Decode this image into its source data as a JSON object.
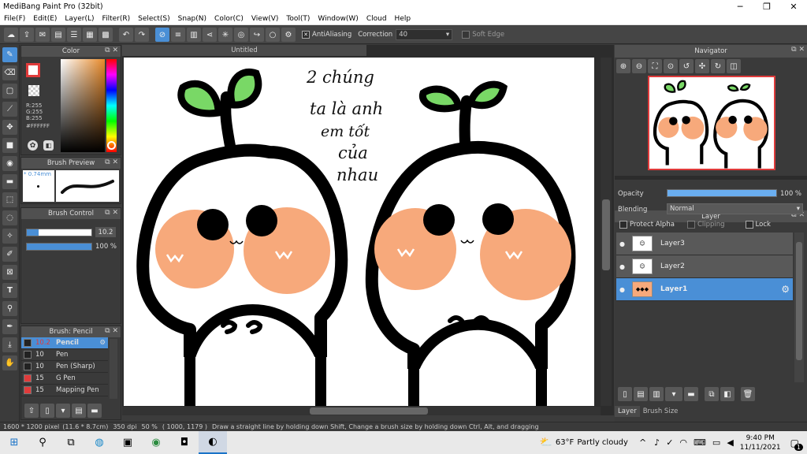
{
  "window": {
    "title": "MediBang Paint Pro (32bit)"
  },
  "menu": [
    "File(F)",
    "Edit(E)",
    "Layer(L)",
    "Filter(R)",
    "Select(S)",
    "Snap(N)",
    "Color(C)",
    "View(V)",
    "Tool(T)",
    "Window(W)",
    "Cloud",
    "Help"
  ],
  "toolbar": {
    "antialiasing": "AntiAliasing",
    "correction_label": "Correction",
    "correction_value": "40",
    "soft_edge": "Soft Edge"
  },
  "color_panel": {
    "title": "Color",
    "r": "R:255",
    "g": "G:255",
    "b": "B:255",
    "hex": "#FFFFFF"
  },
  "brush_preview": {
    "title": "Brush Preview",
    "size": "0.74mm"
  },
  "brush_control": {
    "title": "Brush Control",
    "size": "10.2",
    "opacity": "100 %"
  },
  "brush_list": {
    "title": "Brush: Pencil",
    "items": [
      {
        "size": "10.2",
        "name": "Pencil",
        "color": "#222222"
      },
      {
        "size": "10",
        "name": "Pen",
        "color": "#222222"
      },
      {
        "size": "10",
        "name": "Pen (Sharp)",
        "color": "#222222"
      },
      {
        "size": "15",
        "name": "G Pen",
        "color": "#e03b3b"
      },
      {
        "size": "15",
        "name": "Mapping Pen",
        "color": "#e03b3b"
      }
    ]
  },
  "document": {
    "tab": "Untitled",
    "handwriting": [
      "2 chúng",
      "ta là anh",
      "em tốt",
      "của",
      "nhau"
    ]
  },
  "navigator": {
    "title": "Navigator"
  },
  "layer_panel": {
    "title": "Layer",
    "opacity_label": "Opacity",
    "opacity_value": "100 %",
    "opacity_level": 1.0,
    "blending_label": "Blending",
    "blending_value": "Normal",
    "protect_alpha": "Protect Alpha",
    "clipping": "Clipping",
    "lock": "Lock",
    "layers": [
      {
        "name": "Layer3"
      },
      {
        "name": "Layer2"
      },
      {
        "name": "Layer1"
      }
    ],
    "tabs": [
      "Layer",
      "Brush Size"
    ]
  },
  "status": {
    "pixel": "1600 * 1200 pixel",
    "cm": "(11.6 * 8.7cm)",
    "dpi": "350 dpi",
    "zoom": "50 %",
    "coords": "( 1000, 1179 )",
    "hint": "Draw a straight line by holding down Shift, Change a brush size by holding down Ctrl, Alt, and dragging"
  },
  "taskbar": {
    "weather_temp": "63°F",
    "weather_text": "Partly cloudy",
    "time": "9:40 PM",
    "date": "11/11/2021",
    "notif_count": "1"
  }
}
